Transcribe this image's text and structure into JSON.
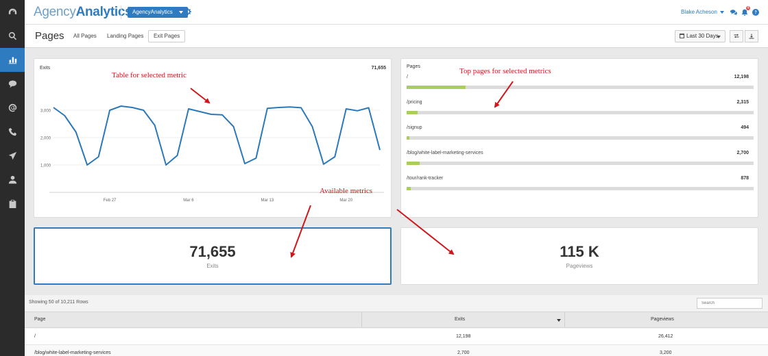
{
  "sidebar": {
    "icons": [
      "dashboard-icon",
      "search-icon",
      "analytics-icon",
      "chat-icon",
      "at-sign-icon",
      "phone-icon",
      "send-icon",
      "user-icon",
      "clipboard-icon"
    ],
    "active_index": 2
  },
  "header": {
    "logo_light": "Agency",
    "logo_bold": "Analytics",
    "account_button": "AgencyAnalytics",
    "user_name": "Blake Acheson",
    "notification_count": "4"
  },
  "subheader": {
    "title": "Pages",
    "tabs": [
      "All Pages",
      "Landing Pages",
      "Exit Pages"
    ],
    "active_tab": "Exit Pages",
    "date_range": "Last 30 Days"
  },
  "chart_card": {
    "label": "Exits",
    "total": "71,655"
  },
  "chart_data": {
    "type": "line",
    "ylabel": "Exits",
    "yticks": [
      "1,000",
      "2,000",
      "3,000"
    ],
    "ylim": [
      0,
      4000
    ],
    "xtick_labels": [
      "Feb 27",
      "Mar 6",
      "Mar 13",
      "Mar 20"
    ],
    "xtick_index": [
      5,
      12,
      19,
      26
    ],
    "color": "#2a78b8",
    "grid": true,
    "series": [
      {
        "values": [
          3100,
          2800,
          2200,
          1000,
          1300,
          3000,
          3150,
          3100,
          3000,
          2450,
          1000,
          1350,
          3050,
          2950,
          2850,
          2830,
          2400,
          1050,
          1250,
          3070,
          3100,
          3120,
          3090,
          2400,
          1030,
          1300,
          3050,
          2980,
          3090,
          1550
        ]
      }
    ]
  },
  "top_pages": {
    "label": "Pages",
    "max": 12198,
    "items": [
      {
        "page": "/",
        "value": "12,198",
        "fraction": 0.17
      },
      {
        "page": "/pricing",
        "value": "2,315",
        "fraction": 0.032
      },
      {
        "page": "/signup",
        "value": "494",
        "fraction": 0.007
      },
      {
        "page": "/blog/white-label-marketing-services",
        "value": "2,700",
        "fraction": 0.037
      },
      {
        "page": "/tour/rank-tracker",
        "value": "878",
        "fraction": 0.012
      }
    ]
  },
  "metrics": [
    {
      "value": "71,655",
      "label": "Exits"
    },
    {
      "value": "115 K",
      "label": "Pageviews"
    }
  ],
  "table": {
    "rows_info": "Showing 50 of 10,211 Rows",
    "search_placeholder": "Search",
    "columns": [
      "Page",
      "Exits",
      "Pageviews"
    ],
    "rows": [
      [
        "/",
        "12,198",
        "26,412"
      ],
      [
        "/blog/white-label-marketing-services",
        "2,700",
        "3,200"
      ]
    ]
  },
  "annotations": {
    "table_note": "Table for selected metric",
    "top_pages_note": "Top pages for selected metrics",
    "metrics_note": "Available metrics"
  },
  "colors": {
    "accent": "#2f7bbf",
    "bar_fill": "#a9cf5a",
    "annotation": "#d0161b"
  }
}
